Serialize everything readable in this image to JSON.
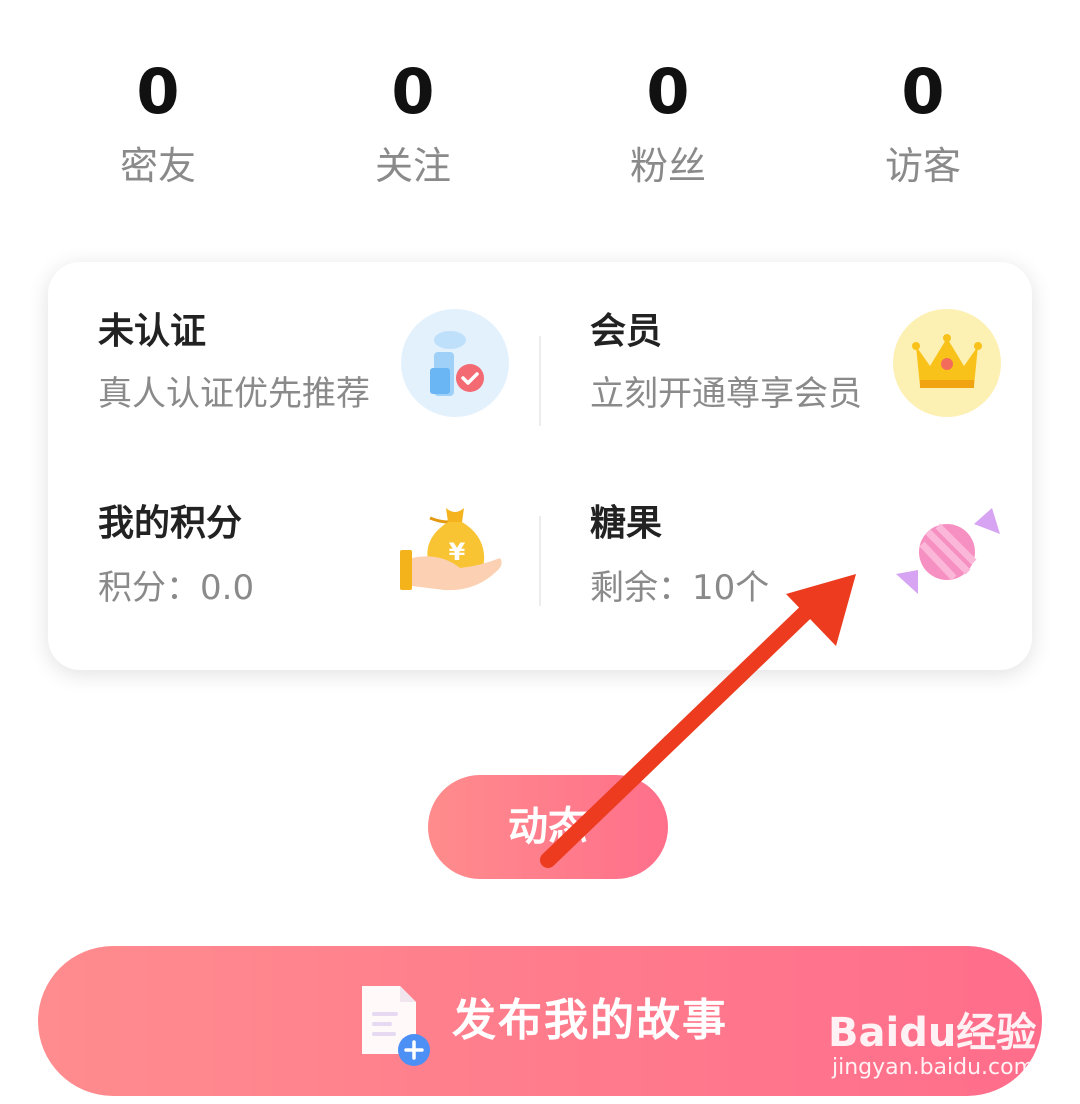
{
  "stats": [
    {
      "value": "0",
      "label": "密友"
    },
    {
      "value": "0",
      "label": "关注"
    },
    {
      "value": "0",
      "label": "粉丝"
    },
    {
      "value": "0",
      "label": "访客"
    }
  ],
  "card": {
    "verify": {
      "title": "未认证",
      "subtitle": "真人认证优先推荐",
      "icon": "verified-user-icon"
    },
    "vip": {
      "title": "会员",
      "subtitle": "立刻开通尊享会员",
      "icon": "crown-icon"
    },
    "points": {
      "title": "我的积分",
      "subtitle": "积分：0.0",
      "icon": "money-bag-icon"
    },
    "candy": {
      "title": "糖果",
      "subtitle": "剩余：10个",
      "icon": "candy-icon"
    }
  },
  "dynamic_label": "动态",
  "publish": {
    "label": "发布我的故事",
    "icon": "add-document-icon"
  },
  "watermark": {
    "brand": "Bai📷经验",
    "brand_text": "Baidu经验",
    "url": "jingyan.baidu.com"
  },
  "colors": {
    "accent_start": "#ff8c8c",
    "accent_end": "#ff6f8b",
    "annotation_arrow": "#ec3b1e"
  }
}
